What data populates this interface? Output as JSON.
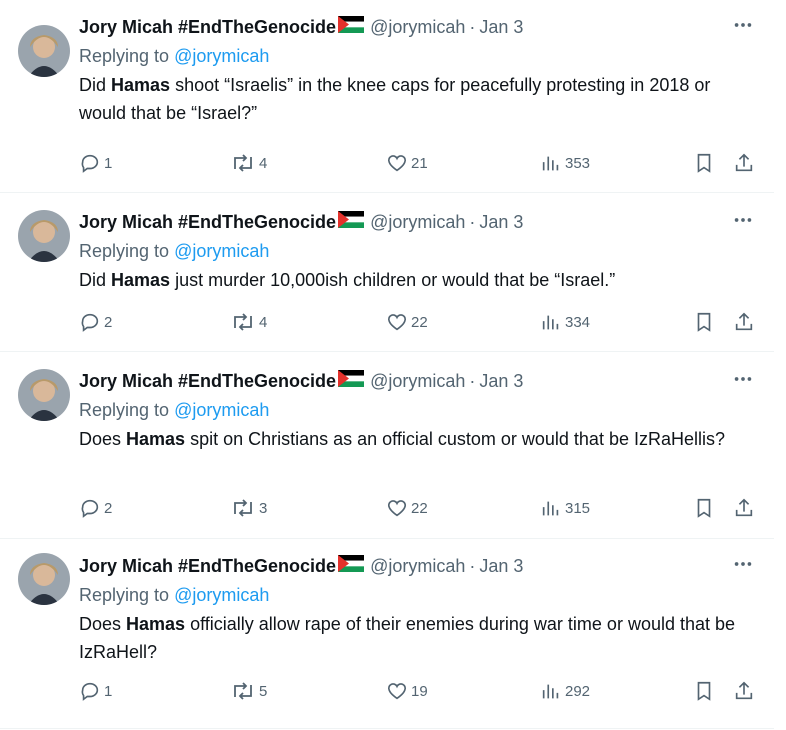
{
  "tweets": [
    {
      "name": "Jory Micah #EndTheGenocide",
      "handle": "@jorymicah",
      "date": "Jan 3",
      "replying_prefix": "Replying to",
      "replying_to": "@jorymicah",
      "text_pre": "Did ",
      "text_bold": "Hamas",
      "text_post": " shoot “Israelis” in the knee caps for peacefully protesting in 2018 or would that be “Israel?”",
      "replies": "1",
      "reposts": "4",
      "likes": "21",
      "views": "353"
    },
    {
      "name": "Jory Micah #EndTheGenocide",
      "handle": "@jorymicah",
      "date": "Jan 3",
      "replying_prefix": "Replying to",
      "replying_to": "@jorymicah",
      "text_pre": "Did ",
      "text_bold": "Hamas",
      "text_post": " just murder 10,000ish children or would that be “Israel.”",
      "replies": "2",
      "reposts": "4",
      "likes": "22",
      "views": "334"
    },
    {
      "name": "Jory Micah #EndTheGenocide",
      "handle": "@jorymicah",
      "date": "Jan 3",
      "replying_prefix": "Replying to",
      "replying_to": "@jorymicah",
      "text_pre": "Does ",
      "text_bold": "Hamas",
      "text_post": " spit on Christians as an official custom or would that be IzRaHellis?",
      "replies": "2",
      "reposts": "3",
      "likes": "22",
      "views": "315"
    },
    {
      "name": "Jory Micah #EndTheGenocide",
      "handle": "@jorymicah",
      "date": "Jan 3",
      "replying_prefix": "Replying to",
      "replying_to": "@jorymicah",
      "text_pre": "Does ",
      "text_bold": "Hamas",
      "text_post": " officially allow rape of their enemies during war time or would that be IzRaHell?",
      "replies": "1",
      "reposts": "5",
      "likes": "19",
      "views": "292"
    }
  ],
  "ui": {
    "separator": "·",
    "more": "···"
  },
  "icons": {
    "reply": "reply-icon",
    "repost": "repost-icon",
    "like": "heart-icon",
    "views": "views-icon",
    "bookmark": "bookmark-icon",
    "share": "share-icon",
    "more": "more-icon",
    "flag": "palestine-flag-icon"
  },
  "colors": {
    "text": "#0f1419",
    "secondary": "#536471",
    "link": "#1d9bf0",
    "divider": "#eff3f4"
  }
}
